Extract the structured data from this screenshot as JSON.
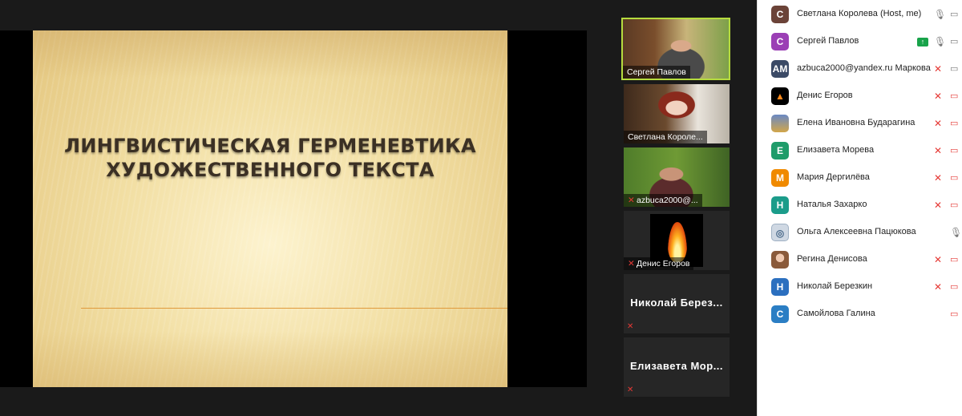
{
  "slide": {
    "title_line1": "ЛИНГВИСТИЧЕСКАЯ ГЕРМЕНЕВТИКА",
    "title_line2": "ХУДОЖЕСТВЕННОГО ТЕКСТА"
  },
  "video_tiles": [
    {
      "label": "Сергей Павлов",
      "active": true,
      "muted": false
    },
    {
      "label": "Светлана Короле...",
      "muted": false
    },
    {
      "label": "azbuca2000@...",
      "muted": true
    },
    {
      "label": "Денис Егоров",
      "muted": true
    },
    {
      "label": "Николай Берез...",
      "muted": true
    },
    {
      "label": "Елизавета Мор...",
      "muted": true
    }
  ],
  "participants": [
    {
      "initials": "С",
      "name": "Светлана Королева (Host, me)",
      "color": "#6b4338",
      "mic": "on",
      "cam": "off",
      "mic_icon": "microphone-icon",
      "cam_icon": "camera-icon"
    },
    {
      "initials": "С",
      "name": "Сергей Павлов",
      "color": "#9b3fb5",
      "mic": "on",
      "cam": "on",
      "sharing": true
    },
    {
      "initials": "AM",
      "name": "azbuca2000@yandex.ru Маркова",
      "color": "#3b4a66",
      "mic": "muted",
      "cam": "on"
    },
    {
      "initials": "",
      "name": "Денис Егоров",
      "color": "#000000",
      "mic": "muted",
      "cam": "off",
      "avatar_icon": "fire-icon"
    },
    {
      "initials": "",
      "name": "Елена Ивановна Бударагина",
      "color": "#6a89c4",
      "mic": "muted",
      "cam": "off",
      "avatar_icon": "photo-icon"
    },
    {
      "initials": "Е",
      "name": "Елизавета Морева",
      "color": "#1f9c6a",
      "mic": "muted",
      "cam": "off"
    },
    {
      "initials": "М",
      "name": "Мария Дергилёва",
      "color": "#f08a00",
      "mic": "muted",
      "cam": "off"
    },
    {
      "initials": "Н",
      "name": "Наталья Захарко",
      "color": "#1b9c8a",
      "mic": "muted",
      "cam": "off"
    },
    {
      "initials": "",
      "name": "Ольга Алексеевна Пацюкова",
      "color": "#cfd8e3",
      "mic": "on",
      "cam": "none",
      "avatar_icon": "pattern-icon"
    },
    {
      "initials": "",
      "name": "Регина Денисова",
      "color": "#b08b7a",
      "mic": "muted",
      "cam": "off",
      "avatar_icon": "photo-icon"
    },
    {
      "initials": "Н",
      "name": "Николай Березкин",
      "color": "#2b6fbf",
      "mic": "muted",
      "cam": "off"
    },
    {
      "initials": "С",
      "name": "Самойлова Галина",
      "color": "#2b7ec4",
      "mic": "none",
      "cam": "off"
    }
  ]
}
